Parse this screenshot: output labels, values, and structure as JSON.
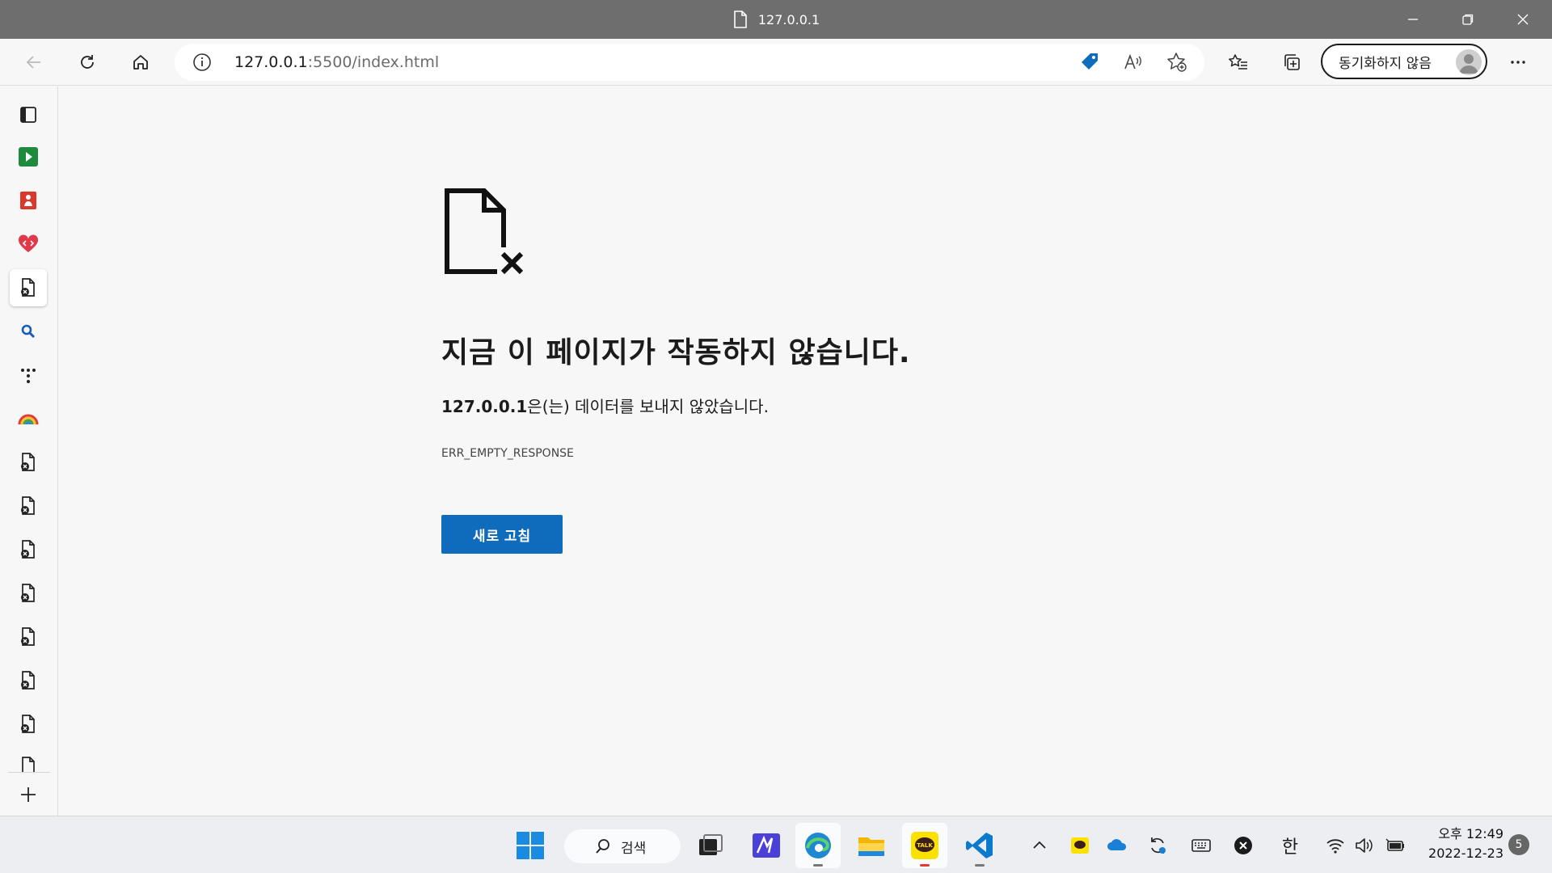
{
  "window": {
    "title": "127.0.0.1"
  },
  "address": {
    "host": "127.0.0.1",
    "rest": ":5500/index.html"
  },
  "profile": {
    "sync_label": "동기화하지 않음"
  },
  "error": {
    "heading": "지금 이 페이지가 작동하지 않습니다.",
    "host": "127.0.0.1",
    "desc_suffix": "은(는) 데이터를 보내지 않았습니다.",
    "code": "ERR_EMPTY_RESPONSE",
    "reload_label": "새로 고침"
  },
  "taskbar": {
    "search_label": "검색",
    "ime": "한",
    "clock_ampm_time": "오후 12:49",
    "clock_date": "2022-12-23",
    "notification_count": "5"
  },
  "icons": {
    "sidebar": [
      "tab-actions-icon",
      "green-play-icon",
      "red-app-icon",
      "heart-code-icon",
      "error-page-icon",
      "search-icon",
      "dots-icon",
      "rainbow-icon",
      "error-page-icon",
      "error-page-icon",
      "error-page-icon",
      "error-page-icon",
      "error-page-icon",
      "error-page-icon",
      "error-page-icon",
      "error-page-icon",
      "add-icon"
    ]
  },
  "colors": {
    "accent": "#0f6cbd",
    "titlebar": "#6e6e6e"
  }
}
